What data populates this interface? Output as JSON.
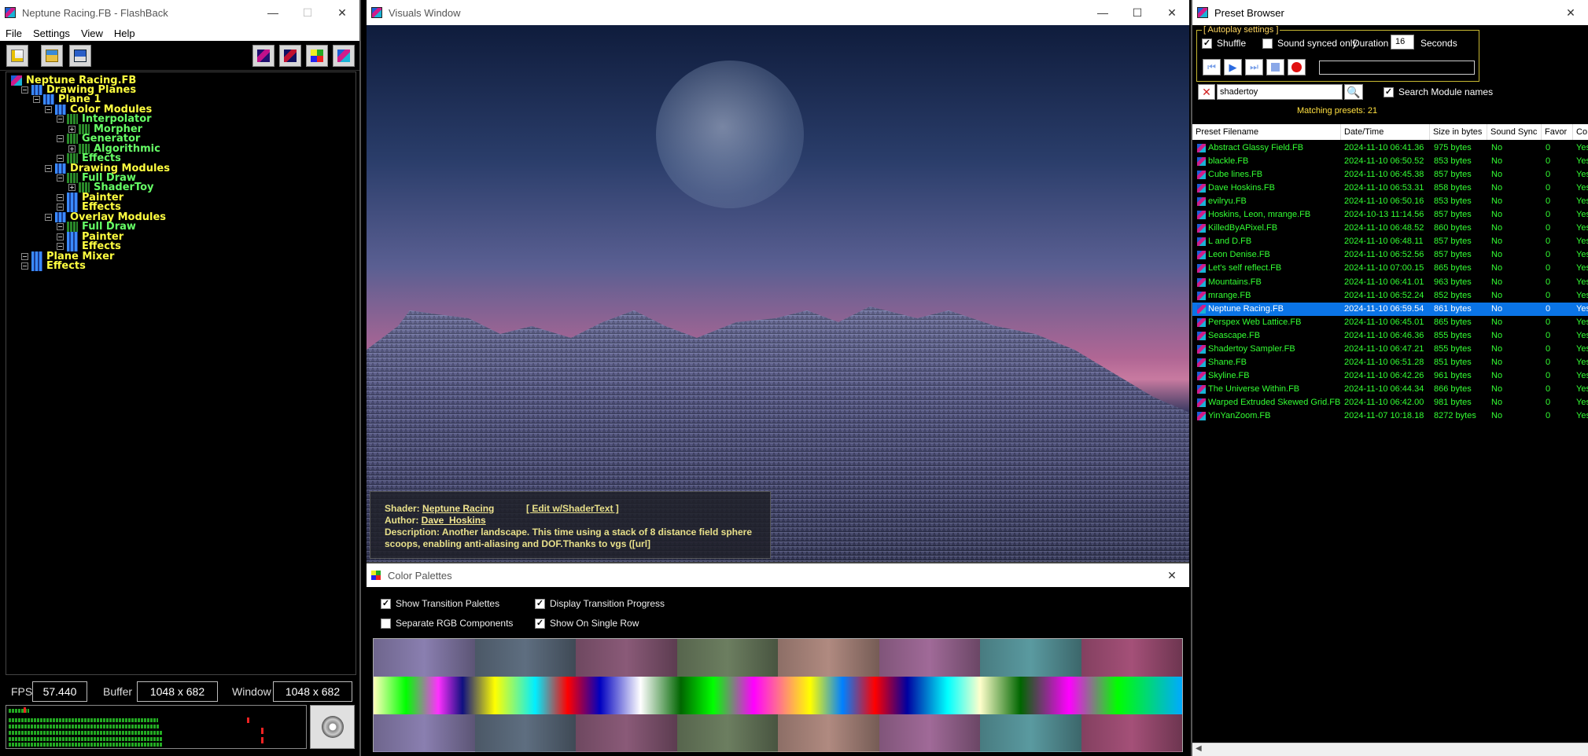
{
  "flashback": {
    "title": "Neptune Racing.FB - FlashBack",
    "menu": [
      "File",
      "Settings",
      "View",
      "Help"
    ],
    "tree": [
      {
        "label": "Neptune Racing.FB",
        "level": 0,
        "color": "y"
      },
      {
        "label": "Drawing Planes",
        "level": 1,
        "color": "y"
      },
      {
        "label": "Plane 1",
        "level": 2,
        "color": "y"
      },
      {
        "label": "Color Modules",
        "level": 3,
        "color": "y"
      },
      {
        "label": "Interpolator",
        "level": 4,
        "color": "g"
      },
      {
        "label": "Morpher",
        "level": 5,
        "color": "g"
      },
      {
        "label": "Generator",
        "level": 4,
        "color": "g"
      },
      {
        "label": "Algorithmic",
        "level": 5,
        "color": "g"
      },
      {
        "label": "Effects",
        "level": 4,
        "color": "g"
      },
      {
        "label": "Drawing Modules",
        "level": 3,
        "color": "y"
      },
      {
        "label": "Full Draw",
        "level": 4,
        "color": "g"
      },
      {
        "label": "ShaderToy",
        "level": 5,
        "color": "g"
      },
      {
        "label": "Painter",
        "level": 4,
        "color": "y"
      },
      {
        "label": "Effects",
        "level": 4,
        "color": "y"
      },
      {
        "label": "Overlay Modules",
        "level": 3,
        "color": "y"
      },
      {
        "label": "Full Draw",
        "level": 4,
        "color": "g"
      },
      {
        "label": "Painter",
        "level": 4,
        "color": "y"
      },
      {
        "label": "Effects",
        "level": 4,
        "color": "y"
      },
      {
        "label": "Plane Mixer",
        "level": 1,
        "color": "y"
      },
      {
        "label": "Effects",
        "level": 1,
        "color": "y"
      }
    ],
    "status": {
      "fps_label": "FPS",
      "fps": "57.440",
      "buffer_label": "Buffer",
      "buffer": "1048 x 682",
      "window_label": "Window",
      "window": "1048 x 682"
    }
  },
  "visuals": {
    "title": "Visuals Window",
    "shader_label": "Shader:",
    "shader": "Neptune Racing",
    "edit": "[ Edit w/ShaderText ]",
    "author_label": "Author:",
    "author": "Dave_Hoskins",
    "desc_label": "Description:",
    "desc": "Another landscape. This time using a stack of 8 distance field sphere scoops, enabling anti-aliasing and DOF.Thanks to vgs ([url]"
  },
  "palettes": {
    "title": "Color Palettes",
    "opts": {
      "show_transition": "Show Transition Palettes",
      "display_progress": "Display Transition Progress",
      "separate_rgb": "Separate RGB Components",
      "single_row": "Show On Single Row"
    },
    "colors": [
      "#8a7fb0",
      "#5e6e80",
      "#8a5a78",
      "#6c7e60",
      "#b08a80",
      "#a06a98",
      "#5a9aa0",
      "#a45078"
    ]
  },
  "presets": {
    "title": "Preset Browser",
    "autoplay_label": "[ Autoplay settings ]",
    "shuffle": "Shuffle",
    "sound_synced": "Sound synced only",
    "duration_label": "Duration",
    "duration": "16",
    "seconds": "Seconds",
    "search_value": "shadertoy",
    "search_module": "Search Module names",
    "matching": "Matching presets: 21",
    "columns": [
      "Preset Filename",
      "Date/Time",
      "Size in bytes",
      "Sound Sync",
      "Favor",
      "Co"
    ],
    "rows": [
      [
        "Abstract Glassy Field.FB",
        "2024-11-10 06:41.36",
        "975 bytes",
        "No",
        "0",
        "Yes"
      ],
      [
        "blackle.FB",
        "2024-11-10 06:50.52",
        "853 bytes",
        "No",
        "0",
        "Yes"
      ],
      [
        "Cube lines.FB",
        "2024-11-10 06:45.38",
        "857 bytes",
        "No",
        "0",
        "Yes"
      ],
      [
        "Dave Hoskins.FB",
        "2024-11-10 06:53.31",
        "858 bytes",
        "No",
        "0",
        "Yes"
      ],
      [
        "evilryu.FB",
        "2024-11-10 06:50.16",
        "853 bytes",
        "No",
        "0",
        "Yes"
      ],
      [
        "Hoskins, Leon, mrange.FB",
        "2024-10-13 11:14.56",
        "857 bytes",
        "No",
        "0",
        "Yes"
      ],
      [
        "KilledByAPixel.FB",
        "2024-11-10 06:48.52",
        "860 bytes",
        "No",
        "0",
        "Yes"
      ],
      [
        "L and D.FB",
        "2024-11-10 06:48.11",
        "857 bytes",
        "No",
        "0",
        "Yes"
      ],
      [
        "Leon Denise.FB",
        "2024-11-10 06:52.56",
        "857 bytes",
        "No",
        "0",
        "Yes"
      ],
      [
        "Let's self reflect.FB",
        "2024-11-10 07:00.15",
        "865 bytes",
        "No",
        "0",
        "Yes"
      ],
      [
        "Mountains.FB",
        "2024-11-10 06:41.01",
        "963 bytes",
        "No",
        "0",
        "Yes"
      ],
      [
        "mrange.FB",
        "2024-11-10 06:52.24",
        "852 bytes",
        "No",
        "0",
        "Yes"
      ],
      [
        "Neptune Racing.FB",
        "2024-11-10 06:59.54",
        "861 bytes",
        "No",
        "0",
        "Yes"
      ],
      [
        "Perspex Web Lattice.FB",
        "2024-11-10 06:45.01",
        "865 bytes",
        "No",
        "0",
        "Yes"
      ],
      [
        "Seascape.FB",
        "2024-11-10 06:46.36",
        "855 bytes",
        "No",
        "0",
        "Yes"
      ],
      [
        "Shadertoy Sampler.FB",
        "2024-11-10 06:47.21",
        "855 bytes",
        "No",
        "0",
        "Yes"
      ],
      [
        "Shane.FB",
        "2024-11-10 06:51.28",
        "851 bytes",
        "No",
        "0",
        "Yes"
      ],
      [
        "Skyline.FB",
        "2024-11-10 06:42.26",
        "961 bytes",
        "No",
        "0",
        "Yes"
      ],
      [
        "The Universe Within.FB",
        "2024-11-10 06:44.34",
        "866 bytes",
        "No",
        "0",
        "Yes"
      ],
      [
        "Warped Extruded Skewed Grid.FB",
        "2024-11-10 06:42.00",
        "981 bytes",
        "No",
        "0",
        "Yes"
      ],
      [
        "YinYanZoom.FB",
        "2024-11-07 10:18.18",
        "8272 bytes",
        "No",
        "0",
        "Yes"
      ]
    ],
    "selected_index": 12
  }
}
